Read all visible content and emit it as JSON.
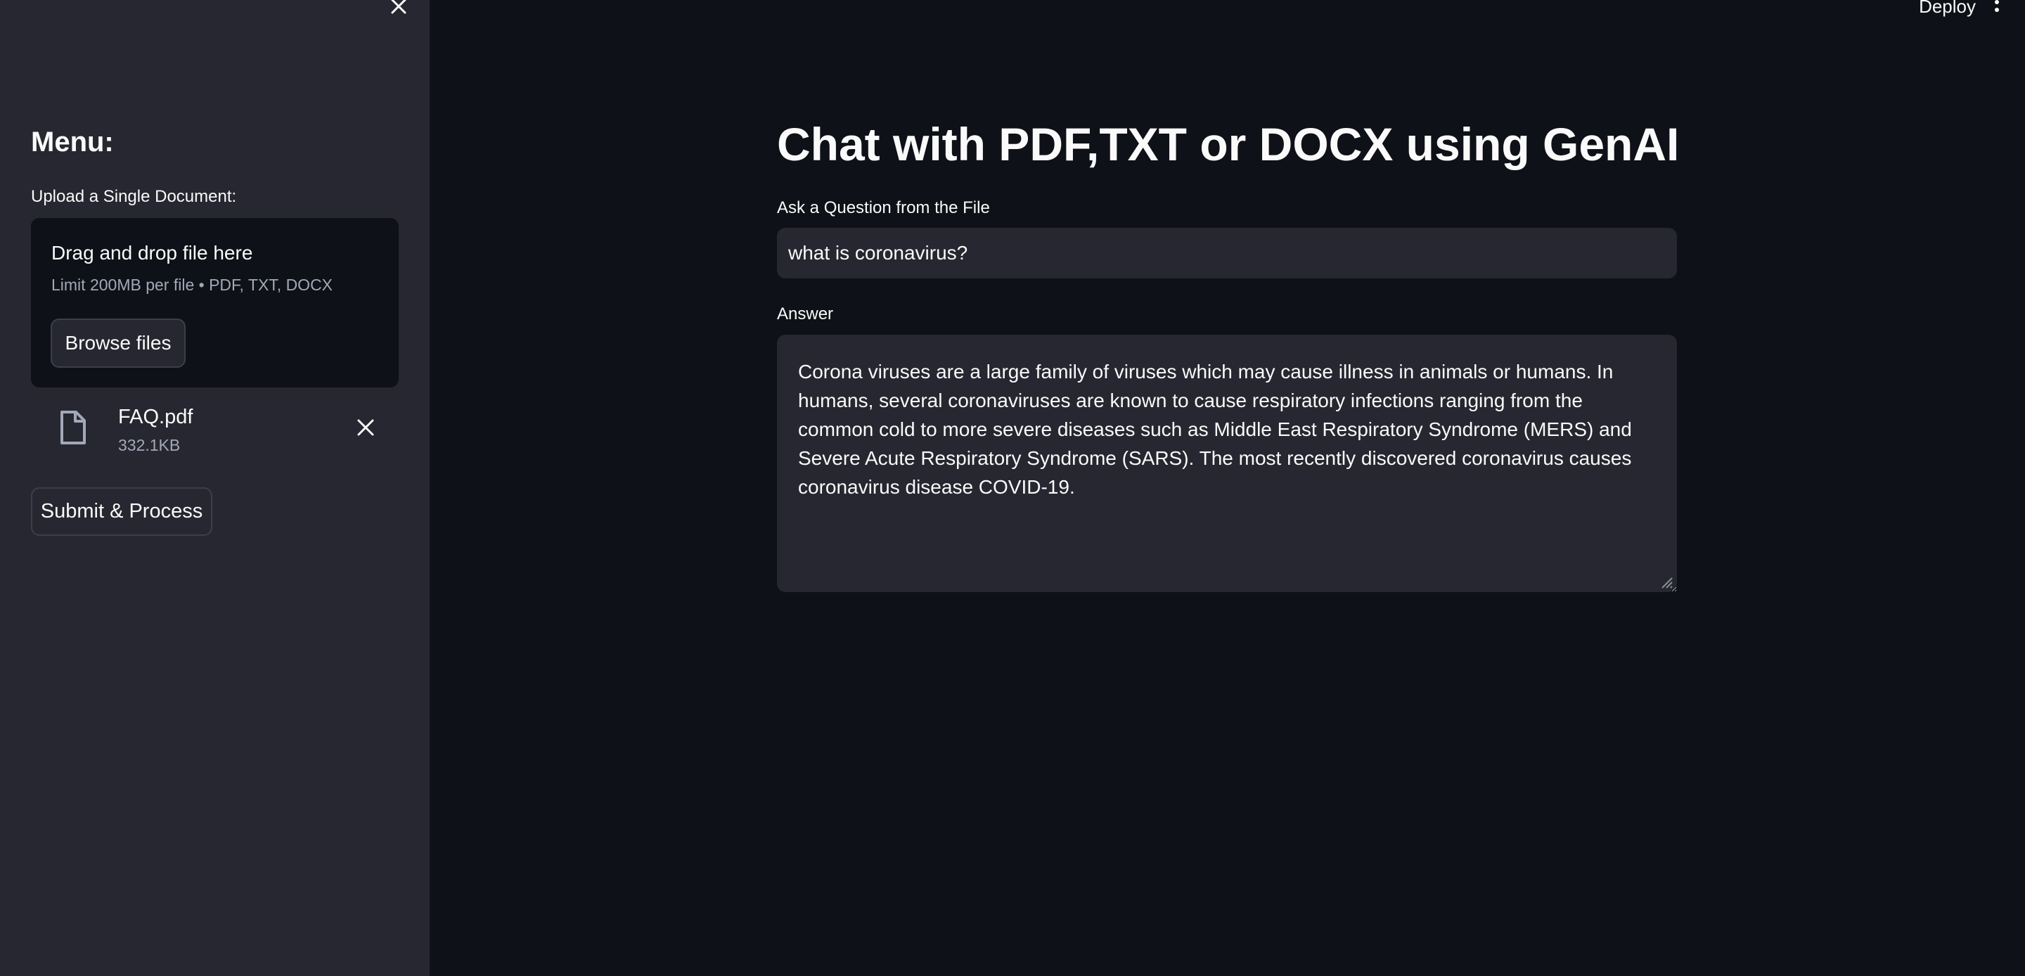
{
  "sidebar": {
    "menu_title": "Menu:",
    "upload_label": "Upload a Single Document:",
    "dropzone": {
      "title": "Drag and drop file here",
      "limit": "Limit 200MB per file • PDF, TXT, DOCX",
      "browse_label": "Browse files"
    },
    "file": {
      "name": "FAQ.pdf",
      "size": "332.1KB",
      "icon": "file-icon"
    },
    "submit_label": "Submit & Process"
  },
  "header": {
    "deploy_label": "Deploy"
  },
  "main": {
    "title": "Chat with PDF,TXT or DOCX using GenAI",
    "question_label": "Ask a Question from the File",
    "question_value": "what is coronavirus?",
    "answer_label": "Answer",
    "answer_value": "Corona viruses are a large family of viruses which may cause illness in animals or humans. In humans, several coronaviruses are known to cause respiratory infections ranging from the common cold to more severe diseases such as Middle East Respiratory Syndrome (MERS) and Severe Acute Respiratory Syndrome (SARS). The most recently discovered coronavirus causes coronavirus disease COVID-19."
  },
  "colors": {
    "background": "#0e1117",
    "sidebar": "#262730",
    "input": "#262730",
    "text": "#fafafa",
    "muted": "#a3a8b8"
  }
}
